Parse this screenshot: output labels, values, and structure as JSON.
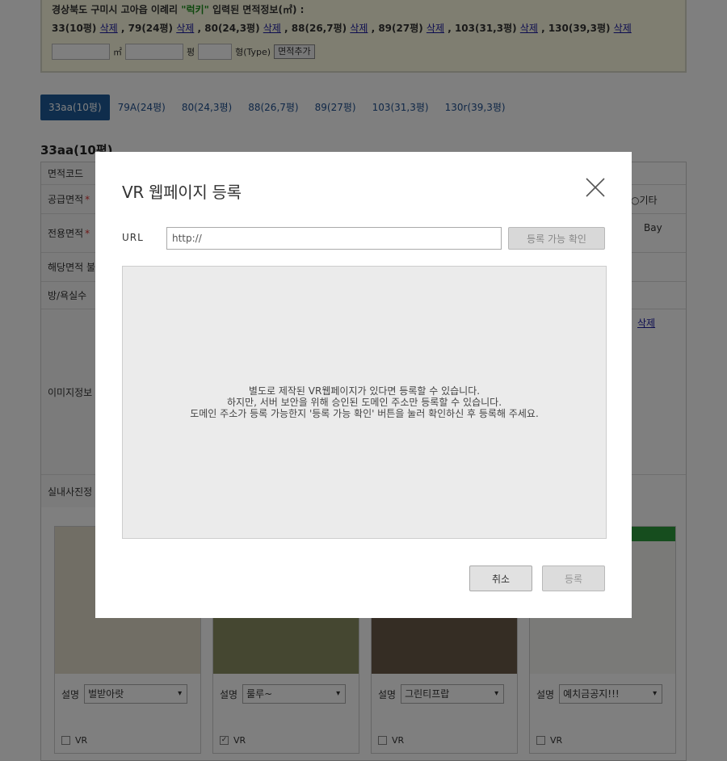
{
  "info": {
    "title_prefix": "경상북도 구미시 고아읍 이례리 ",
    "title_highlight": "\"럭키\"",
    "title_suffix": " 입력된 면적정보(㎡) :",
    "items": [
      {
        "label": "33(10평)",
        "delete": "삭제",
        "sep": " , "
      },
      {
        "label": "79(24평)",
        "delete": "삭제",
        "sep": " , "
      },
      {
        "label": "80(24,3평)",
        "delete": "삭제",
        "sep": " , "
      },
      {
        "label": "88(26,7평)",
        "delete": "삭제",
        "sep": " , "
      },
      {
        "label": "89(27평)",
        "delete": "삭제",
        "sep": " , "
      },
      {
        "label": "103(31,3평)",
        "delete": "삭제",
        "sep": " , "
      },
      {
        "label": "130(39,3평)",
        "delete": "삭제",
        "sep": ""
      }
    ],
    "unit_m2": "㎡",
    "unit_pyeong": "평",
    "unit_type": "형(Type)",
    "add_button": "면적추가"
  },
  "tabs": [
    {
      "label": "33aa(10평)",
      "active": true
    },
    {
      "label": "79A(24평)",
      "active": false
    },
    {
      "label": "80(24,3평)",
      "active": false
    },
    {
      "label": "88(26,7평)",
      "active": false
    },
    {
      "label": "89(27평)",
      "active": false
    },
    {
      "label": "103(31,3평)",
      "active": false
    },
    {
      "label": "130r(39,3평)",
      "active": false
    }
  ],
  "section_title": "33aa(10평)",
  "form_rows": {
    "area_code": "면적코드",
    "supply_area": "공급면적",
    "exclusive_area": "전용면적",
    "area_fragment": "해당면적 불",
    "rooms": "방/욕실수",
    "image_info": "이미지정보",
    "interior_photo": "실내사진정",
    "required": "*",
    "other": "기타",
    "bay": "Bay",
    "delete": "삭제"
  },
  "cards": [
    {
      "desc_label": "설명",
      "desc_value": "벌받아랏",
      "vr_label": "VR",
      "vr_checked": false
    },
    {
      "desc_label": "설명",
      "desc_value": "룰루~",
      "vr_label": "VR",
      "vr_checked": true
    },
    {
      "desc_label": "설명",
      "desc_value": "그린티프랍",
      "vr_label": "VR",
      "vr_checked": false
    },
    {
      "desc_label": "설명",
      "desc_value": "예치금공지!!!",
      "vr_label": "VR",
      "vr_checked": false
    }
  ],
  "modal": {
    "title": "VR 웹페이지 등록",
    "url_label": "URL",
    "url_value": "http://",
    "check_button": "등록 가능 확인",
    "preview_line1": "별도로 제작된 VR웹페이지가 있다면 등록할 수 있습니다.",
    "preview_line2": "하지만, 서버 보안을 위해 승인된 도메인 주소만 등록할 수 있습니다.",
    "preview_line3": "도메인 주소가 등록 가능한지 '등록 가능 확인' 버튼을 눌러 확인하신 후 등록해 주세요.",
    "cancel_button": "취소",
    "submit_button": "등록"
  }
}
